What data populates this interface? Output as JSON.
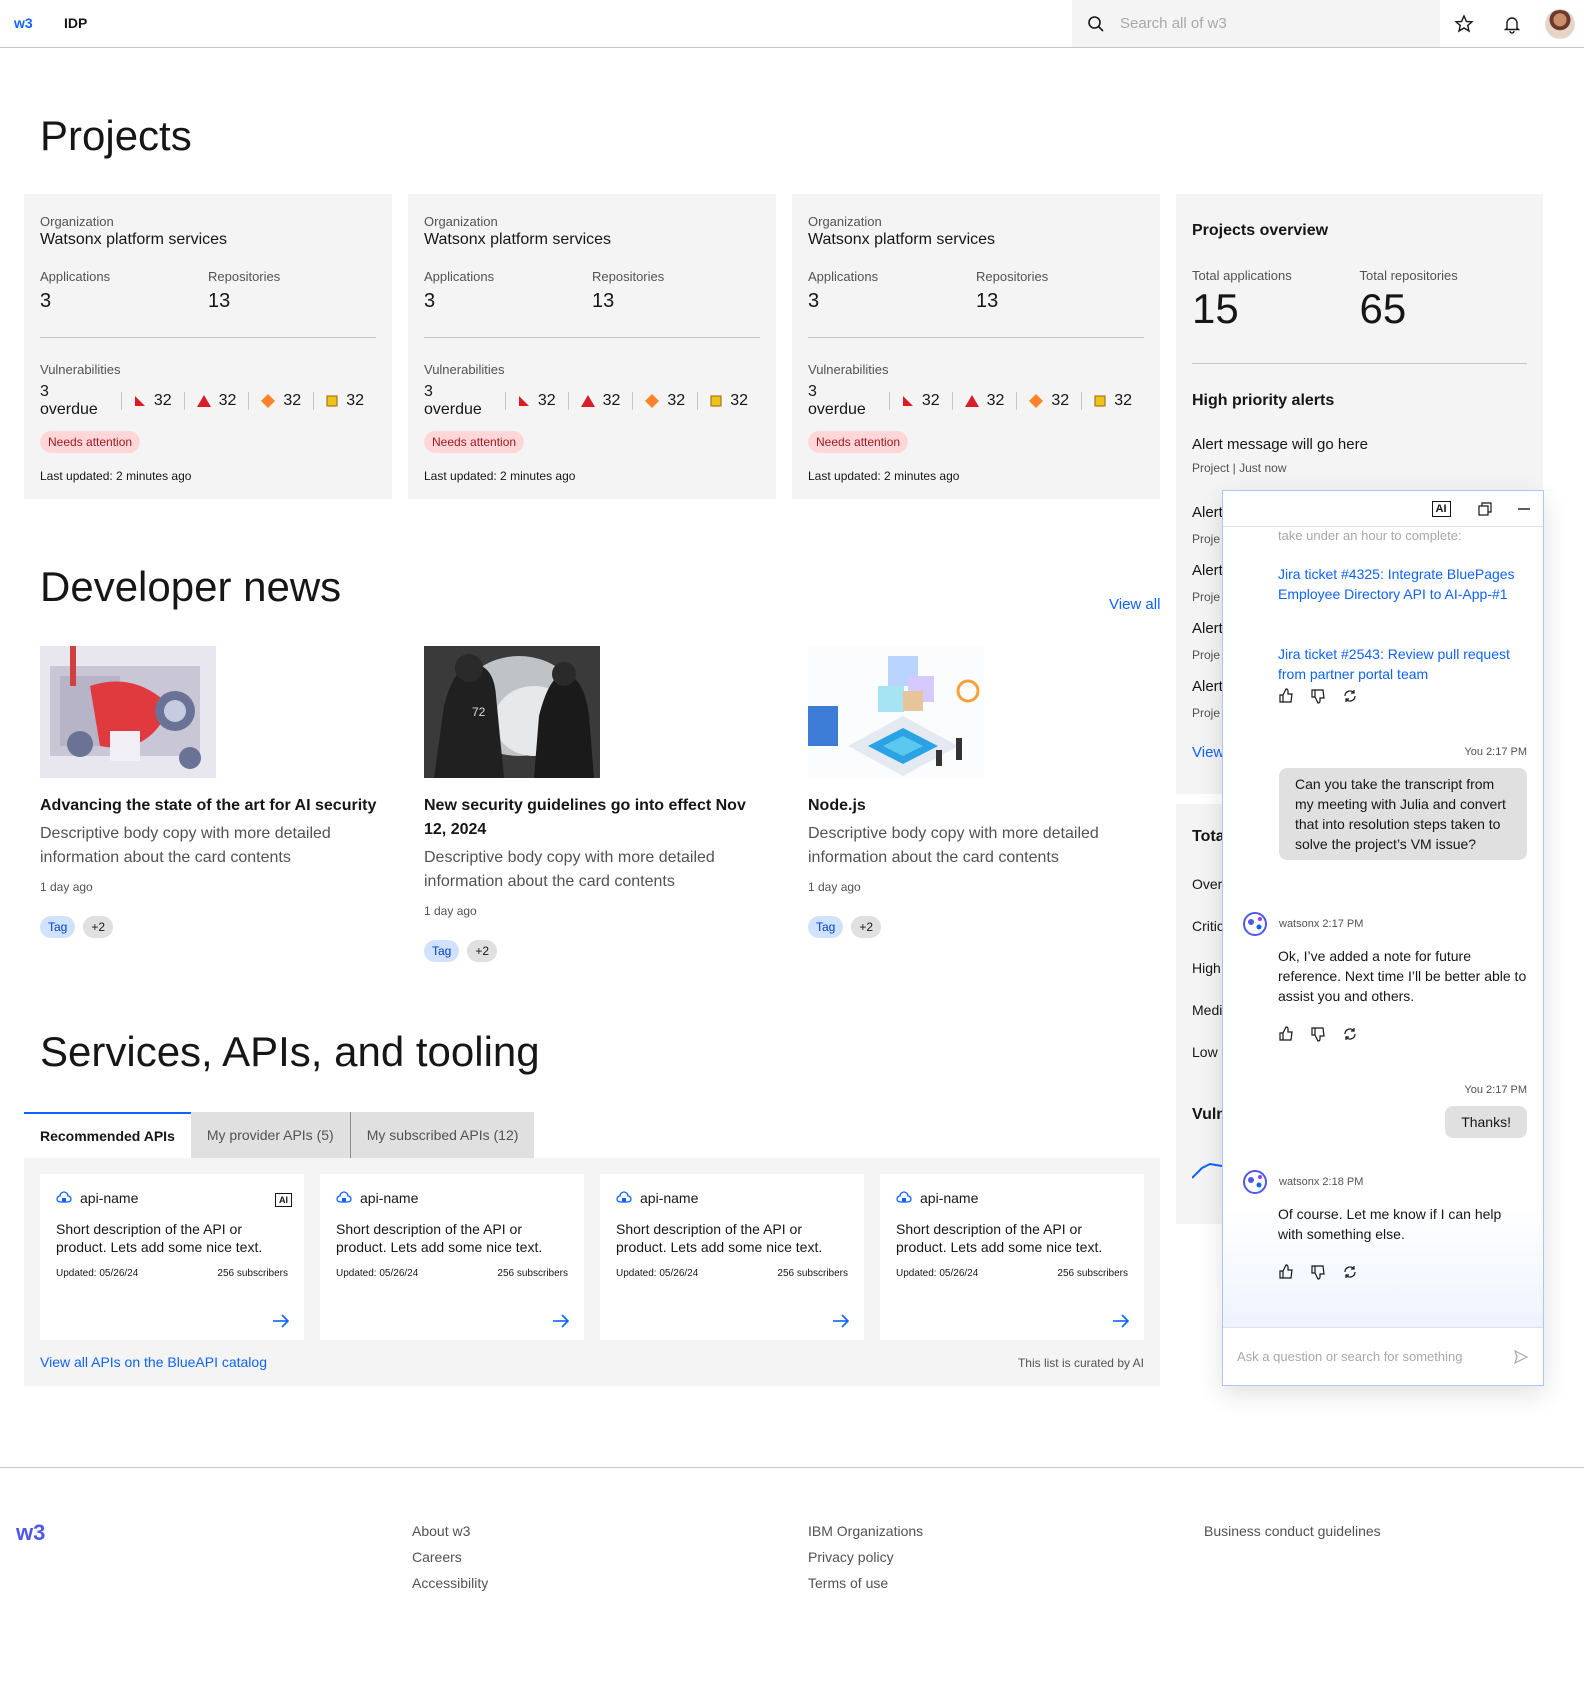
{
  "header": {
    "brand": "w3",
    "app_name": "IDP",
    "search_placeholder": "Search all of w3",
    "icons": [
      "search-icon",
      "star-icon",
      "notification-icon",
      "user-avatar"
    ]
  },
  "projects": {
    "title": "Projects",
    "cards": [
      {
        "org_label": "Organization",
        "org": "Watsonx platform services",
        "apps_label": "Applications",
        "apps": "3",
        "repos_label": "Repositories",
        "repos": "13",
        "vuln_label": "Vulnerabilities",
        "overdue": "3 overdue",
        "sev": [
          "32",
          "32",
          "32",
          "32"
        ],
        "badge": "Needs attention",
        "updated": "Last updated: 2 minutes ago"
      },
      {
        "org_label": "Organization",
        "org": "Watsonx platform services",
        "apps_label": "Applications",
        "apps": "3",
        "repos_label": "Repositories",
        "repos": "13",
        "vuln_label": "Vulnerabilities",
        "overdue": "3 overdue",
        "sev": [
          "32",
          "32",
          "32",
          "32"
        ],
        "badge": "Needs attention",
        "updated": "Last updated: 2 minutes ago"
      },
      {
        "org_label": "Organization",
        "org": "Watsonx platform services",
        "apps_label": "Applications",
        "apps": "3",
        "repos_label": "Repositories",
        "repos": "13",
        "vuln_label": "Vulnerabilities",
        "overdue": "3 overdue",
        "sev": [
          "32",
          "32",
          "32",
          "32"
        ],
        "badge": "Needs attention",
        "updated": "Last updated: 2 minutes ago"
      }
    ]
  },
  "overview": {
    "title": "Projects overview",
    "total_apps_label": "Total applications",
    "total_apps": "15",
    "total_repos_label": "Total repositories",
    "total_repos": "65",
    "alerts_title": "High priority alerts",
    "alert_msg": "Alert message will go here",
    "alert_meta": "Project  |  Just now",
    "alert_stub": "Alert",
    "alert_stub_meta": "Proje",
    "view_link": "View",
    "tota": "Tota",
    "rows": [
      "Over",
      "Critic",
      "High",
      "Medi",
      "Low"
    ],
    "vuln": "Vuln"
  },
  "news": {
    "title": "Developer news",
    "view_all": "View all",
    "items": [
      {
        "title": "Advancing the state of the art for AI security",
        "body": "Descriptive body copy with more detailed information about the card contents",
        "ago": "1 day ago",
        "tag": "Tag",
        "more": "+2"
      },
      {
        "title": "New security guidelines go into effect Nov 12, 2024",
        "body": "Descriptive body copy with more detailed information about the card contents",
        "ago": "1 day ago",
        "tag": "Tag",
        "more": "+2"
      },
      {
        "title": "Node.js",
        "body": "Descriptive body copy with more detailed information about the card contents",
        "ago": "1 day ago",
        "tag": "Tag",
        "more": "+2"
      }
    ]
  },
  "services": {
    "title": "Services, APIs, and tooling",
    "tabs": [
      "Recommended APIs",
      "My provider APIs (5)",
      "My subscribed APIs (12)"
    ],
    "apis": [
      {
        "name": "api-name",
        "desc": "Short description of the API or product. Lets add some nice text.",
        "updated": "Updated: 05/26/24",
        "subs": "256 subscribers",
        "ai": "AI"
      },
      {
        "name": "api-name",
        "desc": "Short description of the API or product. Lets add some nice text.",
        "updated": "Updated: 05/26/24",
        "subs": "256 subscribers"
      },
      {
        "name": "api-name",
        "desc": "Short description of the API or product. Lets add some nice text.",
        "updated": "Updated: 05/26/24",
        "subs": "256 subscribers"
      },
      {
        "name": "api-name",
        "desc": "Short description of the API or product. Lets add some nice text.",
        "updated": "Updated: 05/26/24",
        "subs": "256 subscribers"
      }
    ],
    "catalog_link": "View all APIs on the BlueAPI catalog",
    "curated": "This list is curated by AI"
  },
  "chat": {
    "ai_label": "AI",
    "faded": "take under an hour to complete:",
    "jira1": "Jira ticket #4325: Integrate BluePages Employee Directory API to AI-App-#1",
    "jira2": "Jira ticket #2543: Review pull request from partner portal team",
    "you1": "You 2:17 PM",
    "user1": "Can you take the transcript from my meeting with Julia and convert that into resolution steps taken to solve the project’s VM issue?",
    "wx1": "watsonx 2:17 PM",
    "bot1": "Ok, I’ve added a note for future reference. Next time I’ll be better able to assist you and others.",
    "you2": "You 2:17 PM",
    "user2": "Thanks!",
    "wx2": "watsonx 2:18 PM",
    "bot2": "Of course. Let me know if I can help with something else.",
    "input_placeholder": "Ask a question or search for something"
  },
  "footer": {
    "logo": "w3",
    "col1": [
      "About w3",
      "Careers",
      "Accessibility"
    ],
    "col2": [
      "IBM Organizations",
      "Privacy policy",
      "Terms of use"
    ],
    "col3": [
      "Business conduct guidelines"
    ]
  }
}
